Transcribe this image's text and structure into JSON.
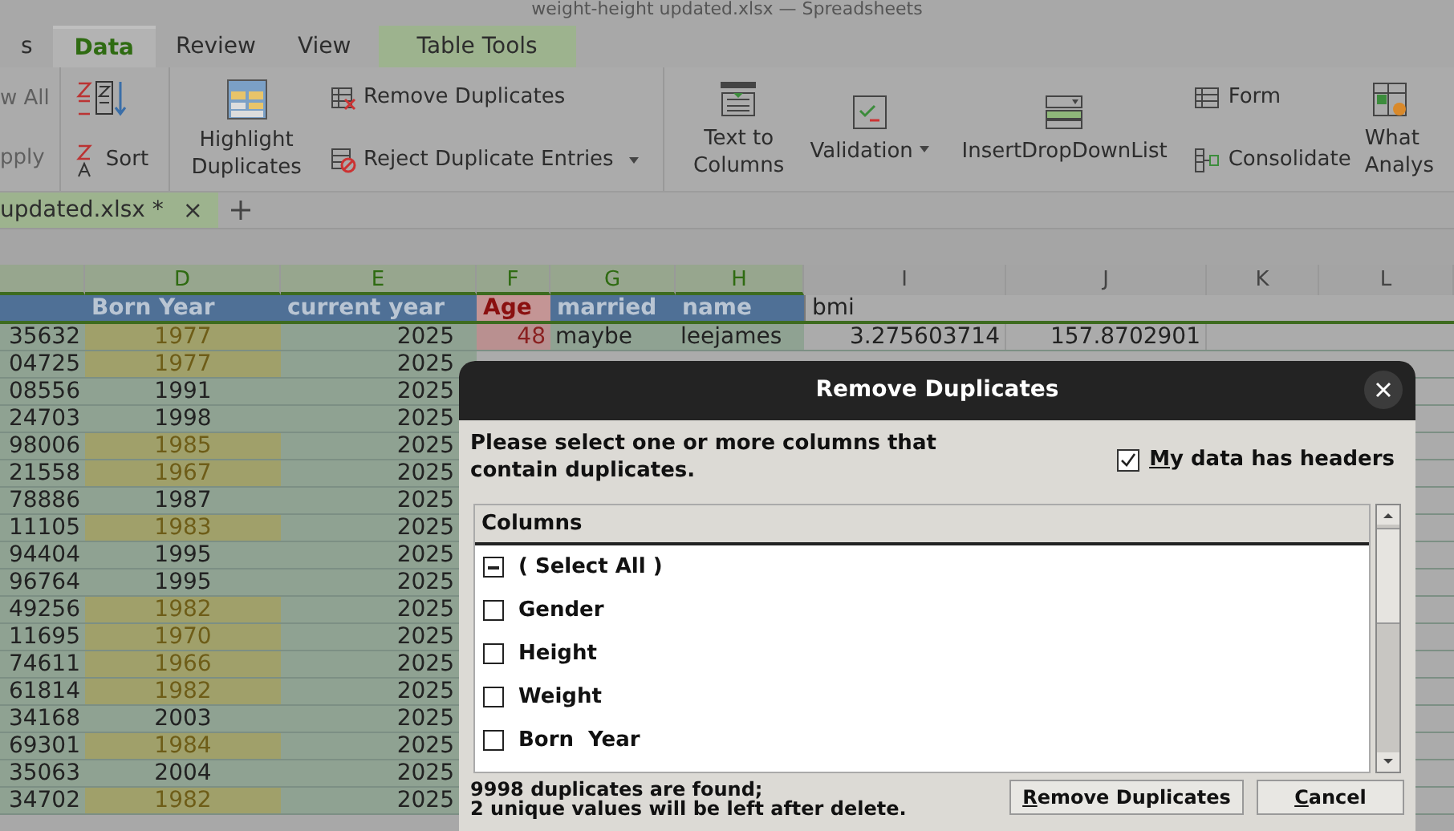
{
  "window": {
    "title": "weight-height updated.xlsx — Spreadsheets"
  },
  "menu_tabs": [
    {
      "label": "s",
      "selected": false,
      "kind": "normal"
    },
    {
      "label": "Data",
      "selected": true,
      "kind": "normal"
    },
    {
      "label": "Review",
      "selected": false,
      "kind": "normal"
    },
    {
      "label": "View",
      "selected": false,
      "kind": "normal"
    },
    {
      "label": "Table Tools",
      "selected": false,
      "kind": "contextual"
    }
  ],
  "ribbon": {
    "filter_items": [
      {
        "label": "w All",
        "disabled": true
      },
      {
        "label": "pply",
        "disabled": true
      }
    ],
    "sort": "Sort",
    "highlight_duplicates": "Highlight Duplicates",
    "remove_duplicates": "Remove Duplicates",
    "reject_duplicate_entries": "Reject Duplicate Entries",
    "text_to_columns": "Text to Columns",
    "validation": "Validation",
    "insert_dropdown_list": "InsertDropDownList",
    "form": "Form",
    "consolidate": "Consolidate",
    "what_if": [
      "What",
      "Analys"
    ]
  },
  "document_tab": {
    "label": "updated.xlsx *",
    "close": "×"
  },
  "sheet": {
    "columns": [
      "",
      "D",
      "E",
      "F",
      "G",
      "H",
      "I",
      "J",
      "K",
      "L"
    ],
    "header_row": [
      {
        "highlighted": false
      },
      {
        "text": "Born  Year",
        "highlighted": false
      },
      {
        "text": "current  year",
        "highlighted": false
      },
      {
        "text": "Age",
        "highlighted": true
      },
      {
        "text": "married",
        "highlighted": false
      },
      {
        "text": "name",
        "highlighted": false
      },
      {
        "text": "bmi",
        "highlighted": false
      }
    ],
    "rows": [
      {
        "cells": [
          "35632",
          "1977",
          "2025",
          "48",
          "maybe",
          "leejames",
          "3.275603714",
          "157.8702901"
        ],
        "duplicate": true,
        "age_highlighted": true
      },
      {
        "cells": [
          "04725",
          "1977",
          "2025"
        ],
        "duplicate": true
      },
      {
        "cells": [
          "08556",
          "1991",
          "2025"
        ],
        "duplicate": false
      },
      {
        "cells": [
          "24703",
          "1998",
          "2025"
        ],
        "duplicate": false
      },
      {
        "cells": [
          "98006",
          "1985",
          "2025"
        ],
        "duplicate": true
      },
      {
        "cells": [
          "21558",
          "1967",
          "2025"
        ],
        "duplicate": true
      },
      {
        "cells": [
          "78886",
          "1987",
          "2025"
        ],
        "duplicate": false
      },
      {
        "cells": [
          "11105",
          "1983",
          "2025"
        ],
        "duplicate": true
      },
      {
        "cells": [
          "94404",
          "1995",
          "2025"
        ],
        "duplicate": false
      },
      {
        "cells": [
          "96764",
          "1995",
          "2025"
        ],
        "duplicate": false
      },
      {
        "cells": [
          "49256",
          "1982",
          "2025"
        ],
        "duplicate": true
      },
      {
        "cells": [
          "11695",
          "1970",
          "2025"
        ],
        "duplicate": true
      },
      {
        "cells": [
          "74611",
          "1966",
          "2025"
        ],
        "duplicate": true
      },
      {
        "cells": [
          "61814",
          "1982",
          "2025"
        ],
        "duplicate": true
      },
      {
        "cells": [
          "34168",
          "2003",
          "2025"
        ],
        "duplicate": false
      },
      {
        "cells": [
          "69301",
          "1984",
          "2025"
        ],
        "duplicate": true
      },
      {
        "cells": [
          "35063",
          "2004",
          "2025"
        ],
        "duplicate": false
      },
      {
        "cells": [
          "34702",
          "1982",
          "2025"
        ],
        "duplicate": true
      }
    ]
  },
  "dialog": {
    "title": "Remove Duplicates",
    "instruction": "Please select one or more columns that contain duplicates.",
    "headers_checkbox": {
      "label": "My data has headers",
      "checked": true
    },
    "list": {
      "header": "Columns",
      "items": [
        {
          "label": "( Select All )",
          "checked": false,
          "partial": true
        },
        {
          "label": "Gender",
          "checked": false,
          "partial": false
        },
        {
          "label": "Height",
          "checked": false,
          "partial": false
        },
        {
          "label": "Weight",
          "checked": false,
          "partial": false
        },
        {
          "label": "Born  Year",
          "checked": false,
          "partial": false
        }
      ]
    },
    "message": [
      "9998 duplicates are found;",
      "2 unique values will be left after delete."
    ],
    "buttons": [
      "Remove Duplicates",
      "Cancel"
    ]
  }
}
